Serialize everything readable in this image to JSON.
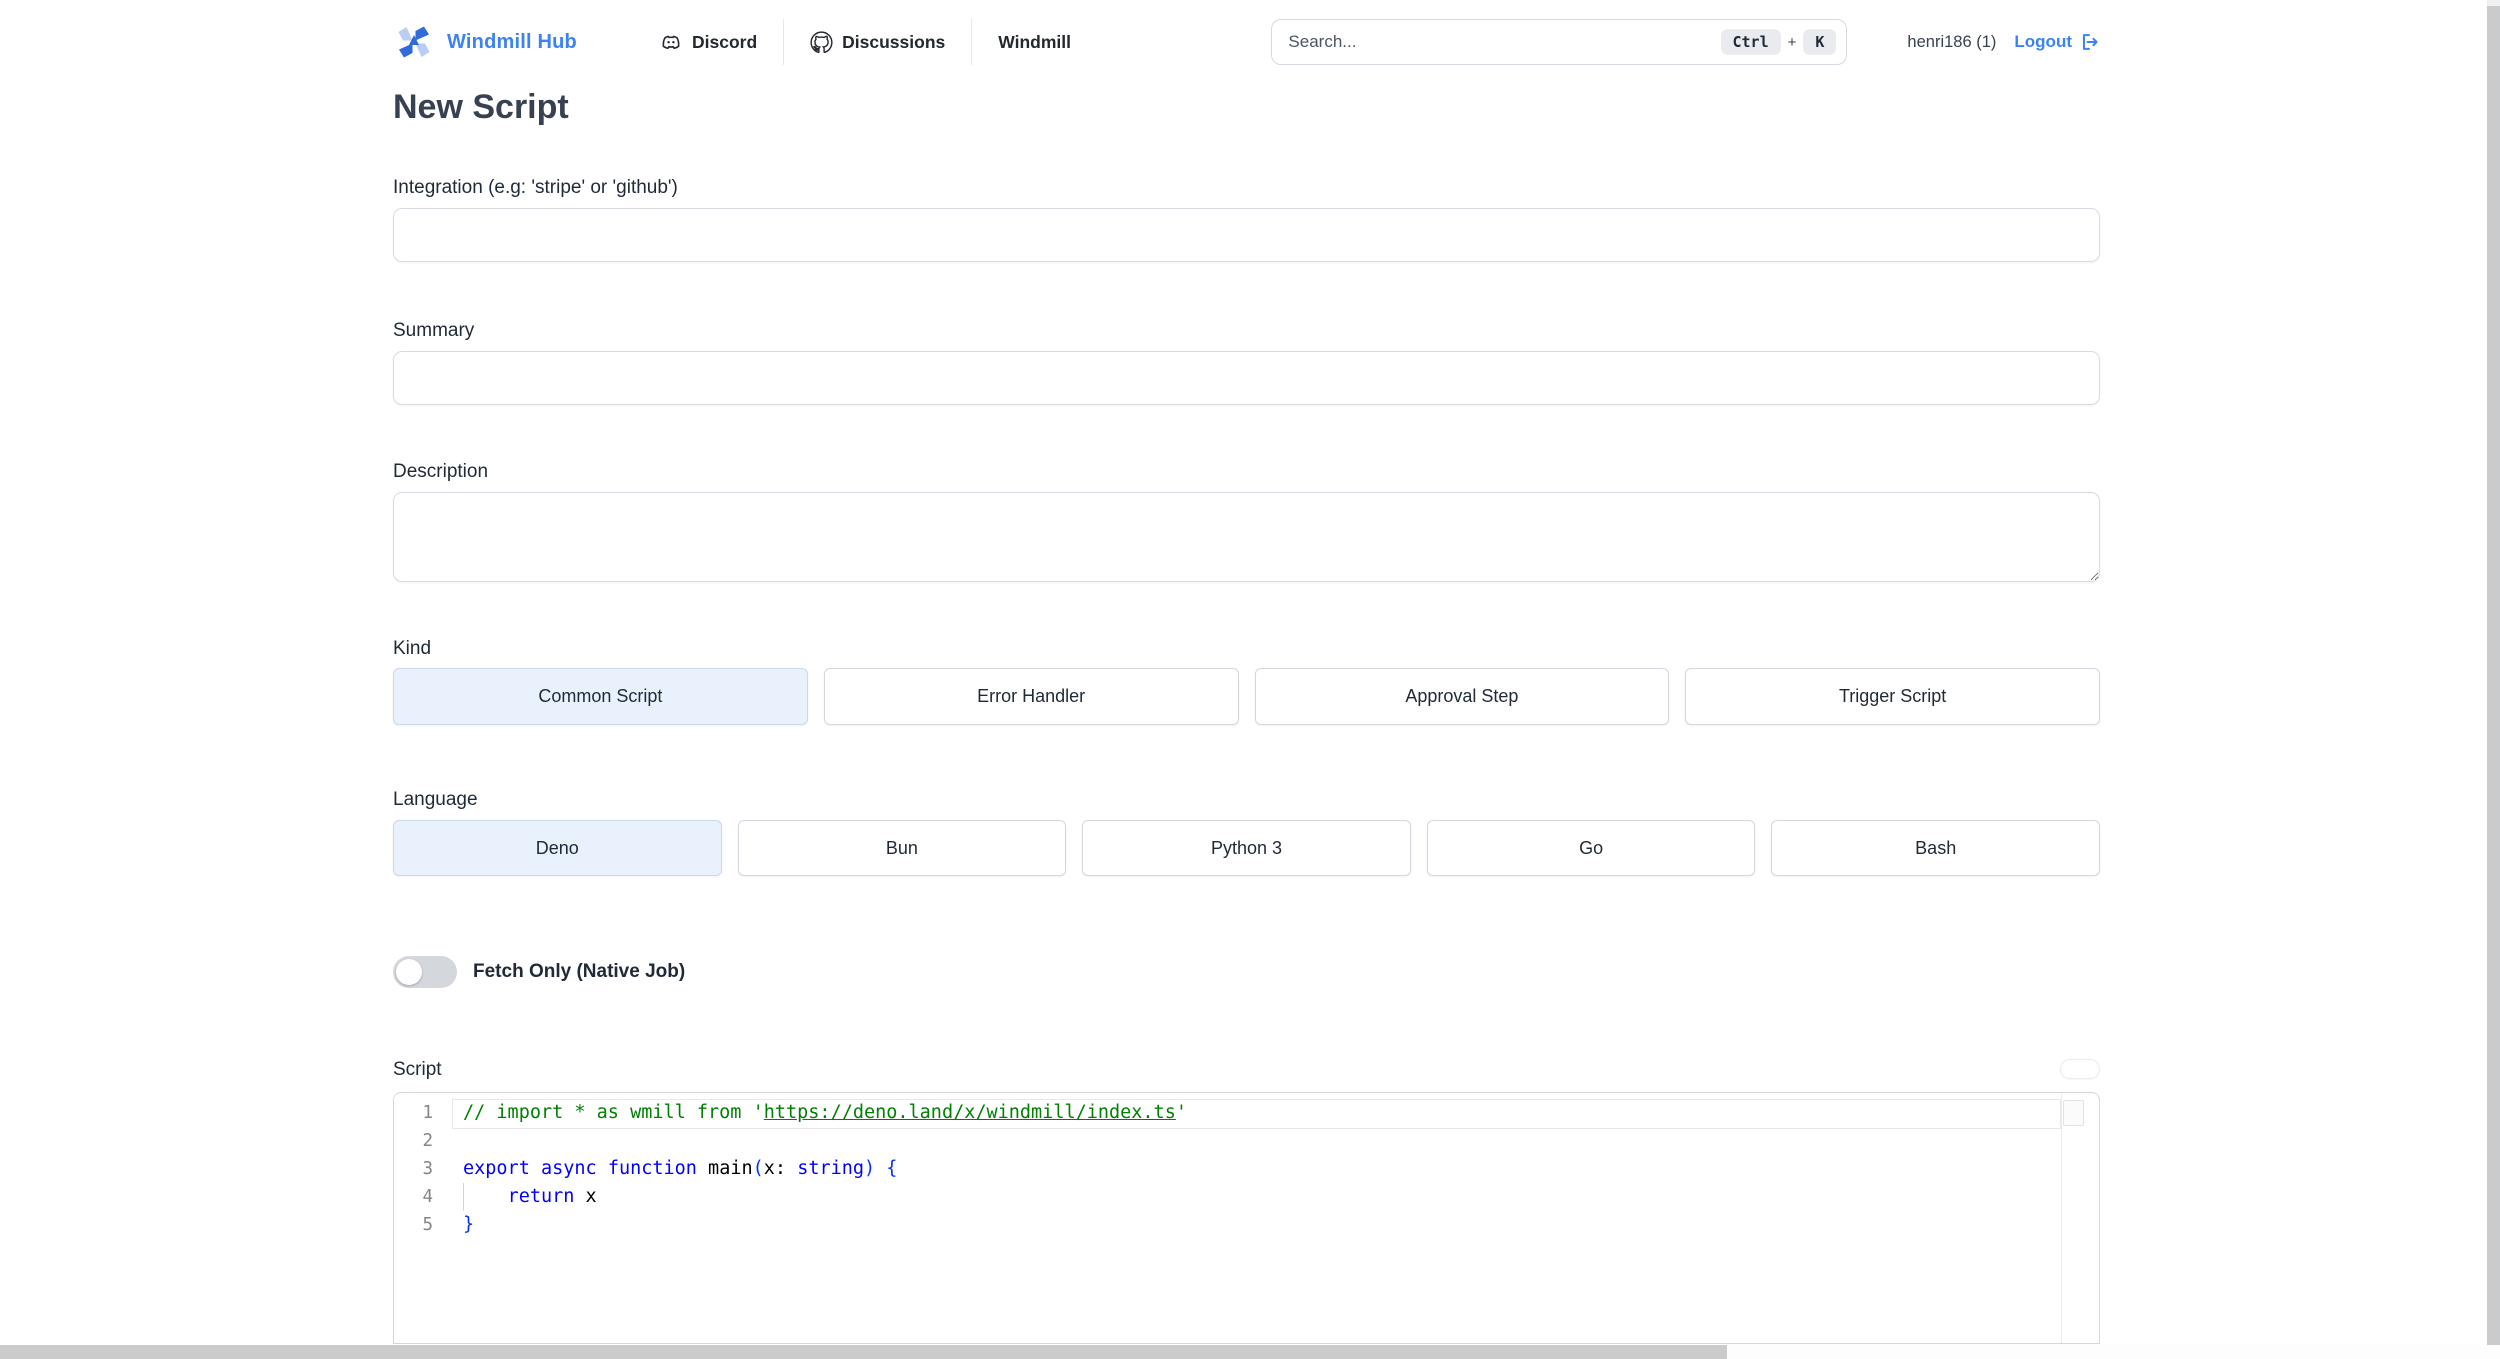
{
  "header": {
    "brand": "Windmill Hub",
    "nav": [
      {
        "label": "Discord"
      },
      {
        "label": "Discussions"
      },
      {
        "label": "Windmill"
      }
    ],
    "search": {
      "placeholder": "Search...",
      "kbd_ctrl": "Ctrl",
      "kbd_plus": "+",
      "kbd_k": "K"
    },
    "user": "henri186 (1)",
    "logout_label": "Logout"
  },
  "page": {
    "title": "New Script"
  },
  "form": {
    "integration": {
      "label": "Integration (e.g: 'stripe' or 'github')",
      "value": ""
    },
    "summary": {
      "label": "Summary",
      "value": ""
    },
    "description": {
      "label": "Description",
      "value": ""
    },
    "kind": {
      "label": "Kind",
      "options": [
        {
          "label": "Common Script",
          "selected": true
        },
        {
          "label": "Error Handler",
          "selected": false
        },
        {
          "label": "Approval Step",
          "selected": false
        },
        {
          "label": "Trigger Script",
          "selected": false
        }
      ]
    },
    "language": {
      "label": "Language",
      "options": [
        {
          "label": "Deno",
          "selected": true
        },
        {
          "label": "Bun",
          "selected": false
        },
        {
          "label": "Python 3",
          "selected": false
        },
        {
          "label": "Go",
          "selected": false
        },
        {
          "label": "Bash",
          "selected": false
        }
      ]
    },
    "fetch_only": {
      "label": "Fetch Only (Native Job)",
      "enabled": false
    },
    "script": {
      "label": "Script"
    }
  },
  "editor": {
    "lines": [
      {
        "num": "1",
        "current": true,
        "tokens": [
          {
            "t": "// import * as wmill from '",
            "c": "comment"
          },
          {
            "t": "https://deno.land/x/windmill/index.ts",
            "c": "comment-link"
          },
          {
            "t": "'",
            "c": "comment"
          }
        ]
      },
      {
        "num": "2",
        "tokens": []
      },
      {
        "num": "3",
        "tokens": [
          {
            "t": "export",
            "c": "keyword"
          },
          {
            "t": " ",
            "c": "plain"
          },
          {
            "t": "async",
            "c": "keyword"
          },
          {
            "t": " ",
            "c": "plain"
          },
          {
            "t": "function",
            "c": "keyword"
          },
          {
            "t": " main",
            "c": "plain"
          },
          {
            "t": "(",
            "c": "bracket"
          },
          {
            "t": "x: ",
            "c": "plain"
          },
          {
            "t": "string",
            "c": "keyword"
          },
          {
            "t": ")",
            "c": "bracket"
          },
          {
            "t": " ",
            "c": "plain"
          },
          {
            "t": "{",
            "c": "bracket"
          }
        ]
      },
      {
        "num": "4",
        "guide": true,
        "tokens": [
          {
            "t": "    ",
            "c": "plain"
          },
          {
            "t": "return",
            "c": "keyword"
          },
          {
            "t": " x",
            "c": "plain"
          }
        ]
      },
      {
        "num": "5",
        "tokens": [
          {
            "t": "}",
            "c": "bracket"
          }
        ]
      }
    ]
  },
  "colors": {
    "accent": "#3b82f6",
    "brand-blue": "#2f6bdb",
    "brand-blue-light": "#b9cdf5",
    "selected-bg": "#e9f1fd",
    "selected-border": "#ccd9ea",
    "toggle-off": "#d4d8dd",
    "code-comment": "#008000",
    "code-keyword": "#0000ff",
    "code-bracket": "#0431fa"
  }
}
